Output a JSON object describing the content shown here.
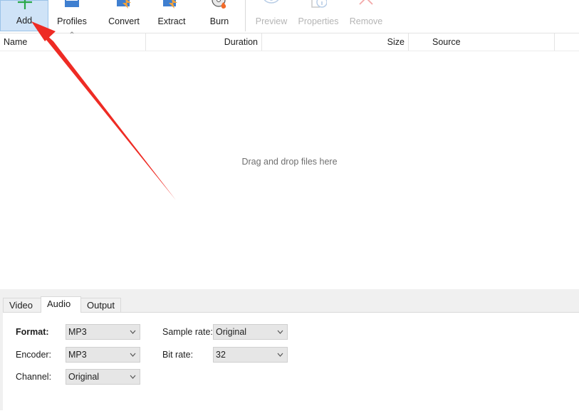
{
  "toolbar": {
    "buttons": [
      {
        "label": "Add"
      },
      {
        "label": "Profiles"
      },
      {
        "label": "Convert"
      },
      {
        "label": "Extract"
      },
      {
        "label": "Burn"
      },
      {
        "label": "Preview"
      },
      {
        "label": "Properties"
      },
      {
        "label": "Remove"
      }
    ]
  },
  "list": {
    "columns": [
      "Name",
      "Duration",
      "Size",
      "Source"
    ],
    "empty_text": "Drag and drop files here"
  },
  "settings": {
    "tabs": [
      "Video",
      "Audio",
      "Output"
    ],
    "active_tab": "Audio",
    "format": {
      "label": "Format:",
      "value": "MP3"
    },
    "encoder": {
      "label": "Encoder:",
      "value": "MP3"
    },
    "channel": {
      "label": "Channel:",
      "value": "Original"
    },
    "sample_rate": {
      "label": "Sample rate:",
      "value": "Original"
    },
    "bit_rate": {
      "label": "Bit rate:",
      "value": "32"
    }
  },
  "colors": {
    "annotation_arrow": "#ee2b24",
    "active_button": "#cfe3f7",
    "add_icon": "#2aa84a"
  }
}
